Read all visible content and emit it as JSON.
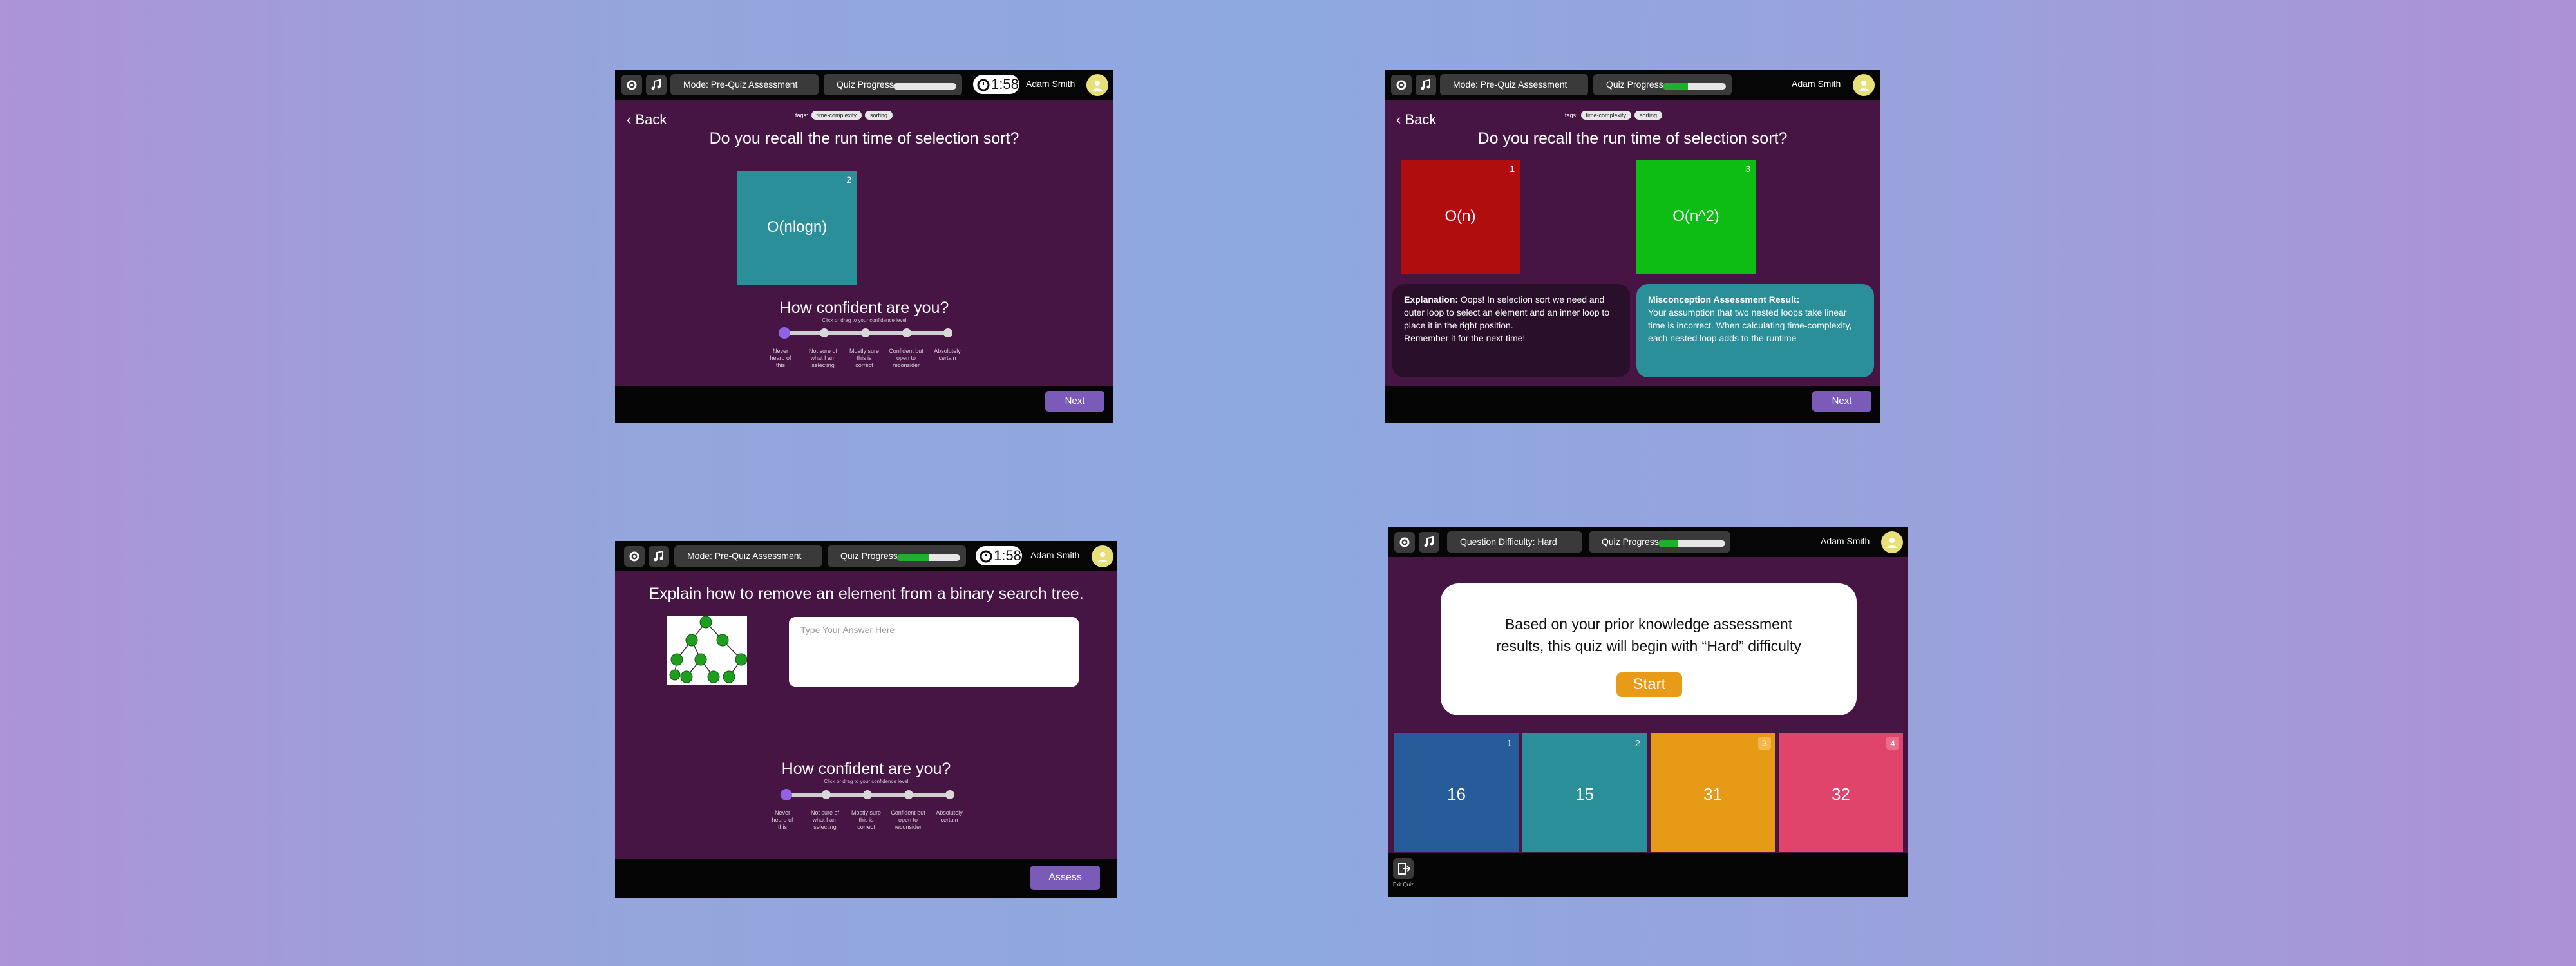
{
  "common": {
    "username": "Adam Smith",
    "progress_label": "Quiz Progress",
    "timer": "1:58",
    "accent": "#461544",
    "icons": [
      "gear-icon",
      "music-icon",
      "timer-icon",
      "avatar-icon"
    ]
  },
  "screen1": {
    "mode": "Mode: Pre-Quiz Assessment",
    "progress": 0.0,
    "back": "Back",
    "tags_label": "tags:",
    "tags": [
      "time-complexity",
      "sorting"
    ],
    "question": "Do you recall the run time of selection sort?",
    "card": {
      "number": "2",
      "text": "O(nlogn)",
      "color": "#2a8f98"
    },
    "confidence_title": "How confident are you?",
    "confidence_sub": "Click or drag to your confidence level",
    "confidence_levels": [
      "Never heard of this",
      "Not sure of what I am selecting",
      "Mostly sure this is correct",
      "Confident but open to reconsider",
      "Absolutely certain"
    ],
    "next": "Next"
  },
  "screen2": {
    "mode": "Mode: Pre-Quiz Assessment",
    "progress": 0.4,
    "back": "Back",
    "tags_label": "tags:",
    "tags": [
      "time-complexity",
      "sorting"
    ],
    "question": "Do you recall the run time of selection sort?",
    "card_a": {
      "number": "1",
      "text": "O(n)",
      "color": "#b00d0f"
    },
    "card_b": {
      "number": "3",
      "text": "O(n^2)",
      "color": "#0dbd13"
    },
    "explanation_title": "Explanation:",
    "explanation": "Oops! In selection sort we need and outer loop to select an element and an inner loop to place it in the right position.",
    "explanation_tail": "Remember it for the next time!",
    "misconception_title": "Misconception Assessment Result:",
    "misconception": "Your assumption that two nested loops take linear time is incorrect. When calculating time-complexity, each nested loop adds to the runtime",
    "next": "Next"
  },
  "screen3": {
    "mode": "Mode: Pre-Quiz Assessment",
    "progress": 0.5,
    "question": "Explain how to remove an element from a binary search tree.",
    "answer_placeholder": "Type Your Answer Here",
    "confidence_title": "How confident are you?",
    "confidence_sub": "Click or drag to your confidence level",
    "confidence_levels": [
      "Never heard of this",
      "Not sure of what I am selecting",
      "Mostly sure this is correct",
      "Confident but open to reconsider",
      "Absolutely certain"
    ],
    "assess": "Assess"
  },
  "screen4": {
    "difficulty": "Question Difficulty: Hard",
    "progress": 0.3,
    "modal_line1": "Based on your prior knowledge assessment",
    "modal_line2": "results, this quiz will begin with “Hard” difficulty",
    "start": "Start",
    "answers": [
      {
        "number": "1",
        "value": "16",
        "color": "#265c9a"
      },
      {
        "number": "2",
        "value": "15",
        "color": "#2a8f98"
      },
      {
        "number": "3",
        "value": "31",
        "color": "#e69a16"
      },
      {
        "number": "4",
        "value": "32",
        "color": "#e0446a"
      }
    ],
    "exit": "Exit Quiz"
  }
}
